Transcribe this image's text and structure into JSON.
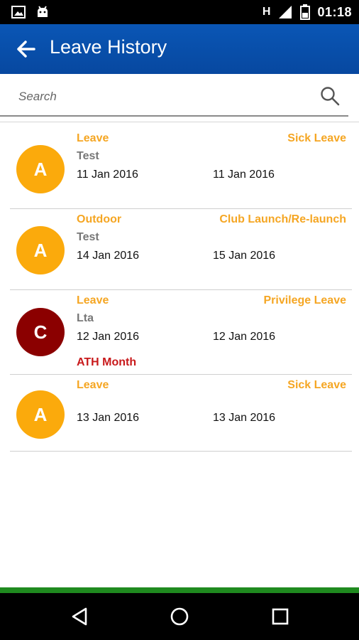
{
  "status_bar": {
    "network_label": "H",
    "time": "01:18",
    "icons": [
      "gallery-icon",
      "android-debug-icon",
      "signal-icon",
      "battery-icon"
    ]
  },
  "header": {
    "title": "Leave History",
    "back_icon": "back-arrow-icon",
    "color": "#0a56b5"
  },
  "search": {
    "placeholder": "Search",
    "value": ""
  },
  "leaves": [
    {
      "initial": "A",
      "avatar_color": "#fbaa0c",
      "category": "Leave",
      "type": "Sick Leave",
      "reason": "Test",
      "from": "11 Jan 2016",
      "to": "11 Jan 2016",
      "note": ""
    },
    {
      "initial": "A",
      "avatar_color": "#fbaa0c",
      "category": "Outdoor",
      "type": "Club Launch/Re-launch",
      "reason": "Test",
      "from": "14 Jan 2016",
      "to": "15 Jan 2016",
      "note": ""
    },
    {
      "initial": "C",
      "avatar_color": "#8b0000",
      "category": "Leave",
      "type": "Privilege Leave",
      "reason": "Lta",
      "from": "12 Jan 2016",
      "to": "12 Jan 2016",
      "note": "ATH Month"
    },
    {
      "initial": "A",
      "avatar_color": "#fbaa0c",
      "category": "Leave",
      "type": "Sick Leave",
      "reason": "",
      "from": "13 Jan 2016",
      "to": "13 Jan 2016",
      "note": ""
    }
  ],
  "colors": {
    "accent_orange": "#f5a623",
    "note_red": "#c8191b",
    "bottom_strip": "#1f8a1f"
  },
  "nav": {
    "icons": [
      "back-triangle-icon",
      "home-circle-icon",
      "recents-square-icon"
    ]
  }
}
